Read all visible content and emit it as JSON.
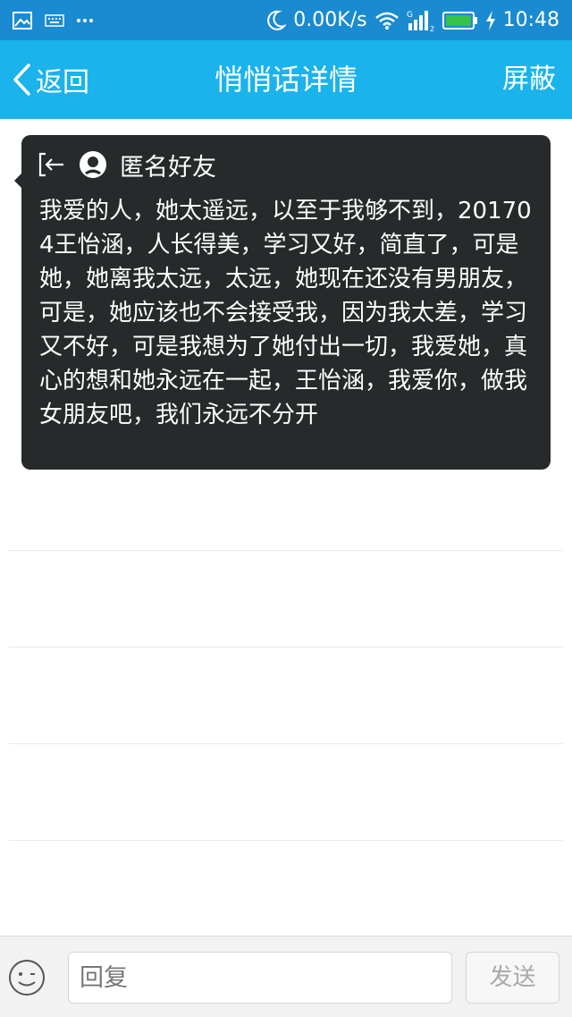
{
  "status_bar": {
    "network_speed": "0.00K/s",
    "time": "10:48",
    "signal_type": "G",
    "sim_slot": "2",
    "battery_level": 1.0,
    "battery_color": "#36c24a",
    "icons": [
      "gallery-icon",
      "keyboard-icon",
      "more-icon",
      "moon-icon",
      "wifi-icon",
      "signal-icon",
      "battery-icon",
      "charging-icon"
    ]
  },
  "header": {
    "back_label": "返回",
    "title": "悄悄话详情",
    "block_label": "屏蔽",
    "background_color": "#1ab3ec"
  },
  "message": {
    "sender": "匿名好友",
    "body": "我爱的人，她太遥远，以至于我够不到，201704王怡涵，人长得美，学习又好，简直了，可是她，她离我太远，太远，她现在还没有男朋友，可是，她应该也不会接受我，因为我太差，学习又不好，可是我想为了她付出一切，我爱她，真心的想和她永远在一起，王怡涵，我爱你，做我女朋友吧，我们永远不分开",
    "card_color": "#262a2b",
    "icons": [
      "exit-icon",
      "avatar-icon"
    ]
  },
  "reply_bar": {
    "placeholder": "回复",
    "send_label": "发送",
    "icons": [
      "emoji-icon"
    ]
  }
}
